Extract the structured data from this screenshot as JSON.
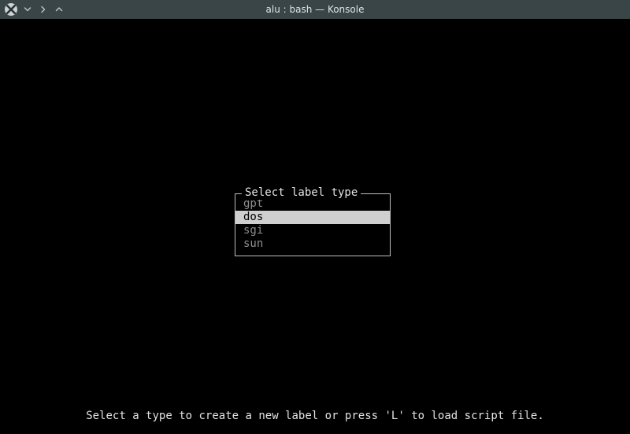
{
  "window": {
    "title": "alu : bash — Konsole"
  },
  "dialog": {
    "title": "Select label type",
    "options": [
      "gpt",
      "dos",
      "sgi",
      "sun"
    ],
    "selected_index": 1
  },
  "hint": "Select a type to create a new label or press 'L' to load script file."
}
